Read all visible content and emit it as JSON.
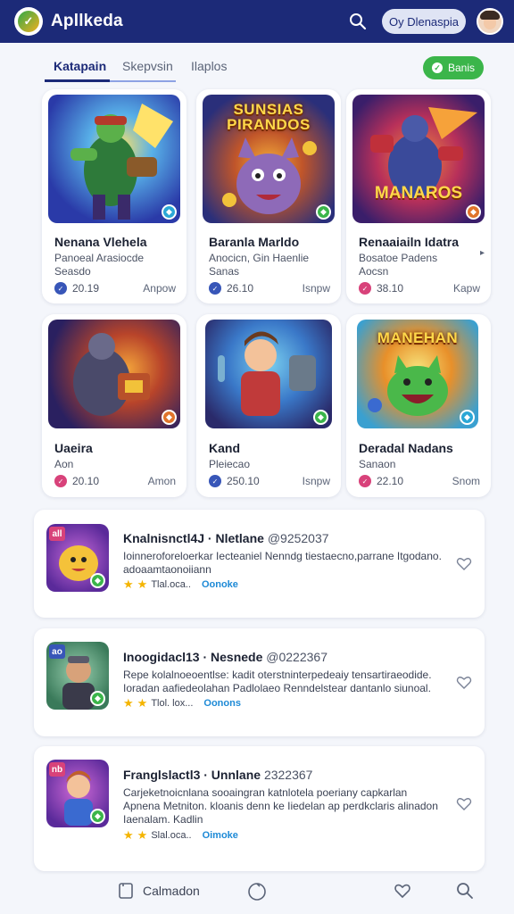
{
  "header": {
    "app_title": "Apllkeda",
    "pill_label": "Oy Dlenaspia"
  },
  "tabs": [
    {
      "label": "Katapain",
      "active": true
    },
    {
      "label": "Skepvsin",
      "active": false
    },
    {
      "label": "Ilaplos",
      "active": false
    }
  ],
  "top_button": {
    "label": "Banis"
  },
  "cards": [
    {
      "name": "Nenana Vlehela",
      "sub1": "Panoeal Arasiocde",
      "sub2": "Seasdo",
      "meta": "20.19",
      "action": "Anpow",
      "thumb_text": "",
      "dot_color": "#3856b8",
      "badge_color": "#2aa7d6"
    },
    {
      "name": "Baranla Marldo",
      "sub1": "Anocicn, Gin Haenlie",
      "sub2": "Sanas",
      "meta": "26.10",
      "action": "Isnpw",
      "thumb_text": "SUNSIAS PIRANDOS",
      "dot_color": "#3856b8",
      "badge_color": "#3bb54a"
    },
    {
      "name": "Renaaiailn Idatra",
      "sub1": "Bosatoe Padens",
      "sub2": "Aocsn",
      "meta": "38.10",
      "action": "Kapw",
      "thumb_text": "MANAROS",
      "dot_color": "#d8427a",
      "badge_color": "#e0742a"
    },
    {
      "name": "Uaeira",
      "sub1": "Aon",
      "sub2": "",
      "meta": "20.10",
      "action": "Amon",
      "thumb_text": "",
      "dot_color": "#d8427a",
      "badge_color": "#e0742a"
    },
    {
      "name": "Kand",
      "sub1": "Pleiecao",
      "sub2": "",
      "meta": "250.10",
      "action": "Isnpw",
      "thumb_text": "",
      "dot_color": "#3856b8",
      "badge_color": "#3bb54a"
    },
    {
      "name": "Deradal Nadans",
      "sub1": "Sanaon",
      "sub2": "",
      "meta": "22.10",
      "action": "Snom",
      "thumb_text": "MANEHAN",
      "dot_color": "#d8427a",
      "badge_color": "#2aa7d6"
    }
  ],
  "list_items": [
    {
      "tag": "all",
      "tag_color": "#d8427a",
      "title": "Knalnisnctl4J · Nletlane",
      "number": "@9252037",
      "desc": "Ioinneroforeloerkar Iecteaniel Nenndg tiestaecno,parrane Itgodano. adoaamtaonoiiann",
      "rating": "Tlal.oca..",
      "link": "Oonoke"
    },
    {
      "tag": "ao",
      "tag_color": "#3856b8",
      "title": "Inoogidacl13 · Nesnede",
      "number": "@0222367",
      "desc": "Repe kolalnoeoentlse: kadit oterstninterpedeaiy tensartiraeodide. Ioradan aafiedeolahan Padlolaeo Renndelstear dantanlo siunoal.",
      "rating": "Tlol. lox...",
      "link": "Oonons"
    },
    {
      "tag": "nb",
      "tag_color": "#d8427a",
      "title": "Franglslactl3 · Unnlane",
      "number": "2322367",
      "desc": "Carjeketnoicnlana sooaingran katnlotela poeriany capkarlan Apnena Metniton. kloanis denn ke Iiedelan ap perdkclaris alinadon Iaenalam. Kadlin",
      "rating": "Slal.oca..",
      "link": "Oimoke"
    }
  ],
  "bottom_nav": {
    "label": "Calmadon"
  }
}
